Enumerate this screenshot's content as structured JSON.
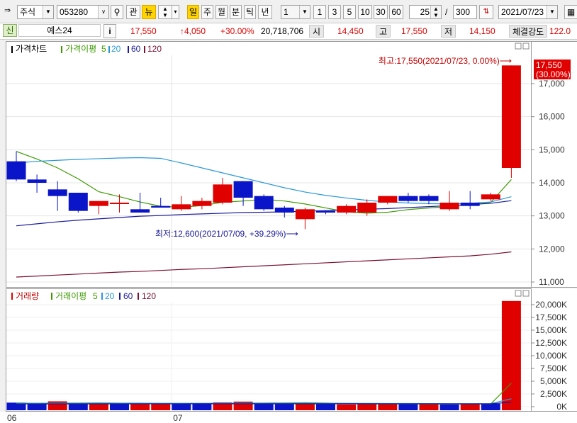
{
  "toolbar": {
    "market_select": "주식",
    "code": "053280",
    "btn_gwan": "관",
    "btn_nyu": "뉴",
    "periods": [
      "일",
      "주",
      "월",
      "분",
      "틱",
      "년"
    ],
    "period_unit": "1",
    "quick_units": [
      "1",
      "3",
      "5",
      "10",
      "30",
      "60"
    ],
    "view_count": "25",
    "slash": "/",
    "total_count": "300",
    "date": "2021/07/23"
  },
  "quote": {
    "badge": "신",
    "name": "예스24",
    "info_btn": "i",
    "price": "17,550",
    "change": "↑4,050",
    "change_pct": "+30.00%",
    "volume": "20,718,706",
    "open_label": "시",
    "open": "14,450",
    "high_label": "고",
    "high": "17,550",
    "low_label": "저",
    "low": "14,150",
    "strength_label": "체결강도",
    "strength": "122.0"
  },
  "price_panel": {
    "legend_title": "가격차트",
    "legend_ma_label": "가격이평",
    "legend_ma_periods": [
      "5",
      "20",
      "60",
      "120"
    ],
    "annotation_high": "최고:17,550(2021/07/23, 0.00%)⟶",
    "annotation_low": "최저:12,600(2021/07/09, +39.29%)⟶",
    "last_price_tag": "17,550",
    "last_pct_tag": "(30.00%)"
  },
  "volume_panel": {
    "legend_title": "거래량",
    "legend_ma_label": "거래이평",
    "legend_ma_periods": [
      "5",
      "20",
      "60",
      "120"
    ]
  },
  "colors": {
    "up": "#e00000",
    "down": "#0a14c8",
    "ma5": "#3c9a00",
    "ma20": "#2a98d8",
    "ma60": "#1a1a9a",
    "ma120": "#7a1030"
  },
  "chart_data": [
    {
      "type": "candlestick",
      "ylim": [
        11000,
        17550
      ],
      "yticks": [
        "11,000",
        "12,000",
        "13,000",
        "14,000",
        "15,000",
        "16,000",
        "17,000"
      ],
      "x_labels": [
        {
          "index": 0,
          "label": "06"
        },
        {
          "index": 8,
          "label": "07"
        }
      ],
      "series": [
        {
          "name": "price",
          "ohlc": [
            [
              14650,
              14950,
              14050,
              14100
            ],
            [
              14100,
              14250,
              13700,
              14000
            ],
            [
              13800,
              14050,
              13150,
              13600
            ],
            [
              13700,
              13700,
              13100,
              13150
            ],
            [
              13300,
              13450,
              13050,
              13450
            ],
            [
              13400,
              13650,
              13100,
              13400
            ],
            [
              13200,
              13700,
              13100,
              13100
            ],
            [
              13300,
              13550,
              13250,
              13250
            ],
            [
              13200,
              13600,
              13150,
              13350
            ],
            [
              13300,
              13550,
              13200,
              13450
            ],
            [
              13400,
              14150,
              13350,
              13950
            ],
            [
              14050,
              14050,
              13300,
              13550
            ],
            [
              13600,
              13650,
              13150,
              13200
            ],
            [
              13250,
              13300,
              12950,
              13100
            ],
            [
              12900,
              13250,
              12600,
              13200
            ],
            [
              13150,
              13150,
              13050,
              13100
            ],
            [
              13100,
              13350,
              13050,
              13300
            ],
            [
              13100,
              13500,
              13000,
              13400
            ],
            [
              13400,
              13600,
              13350,
              13600
            ],
            [
              13600,
              13700,
              13400,
              13450
            ],
            [
              13600,
              13650,
              13350,
              13450
            ],
            [
              13200,
              13750,
              13150,
              13400
            ],
            [
              13400,
              13750,
              13200,
              13300
            ],
            [
              13500,
              13700,
              13450,
              13650
            ],
            [
              14450,
              17550,
              14150,
              17550
            ]
          ]
        },
        {
          "name": "5",
          "values": [
            14950,
            14720,
            14450,
            14120,
            13730,
            13580,
            13420,
            13290,
            13260,
            13310,
            13410,
            13450,
            13500,
            13450,
            13360,
            13240,
            13120,
            13080,
            13110,
            13190,
            13240,
            13280,
            13360,
            13410,
            14100
          ]
        },
        {
          "name": "20",
          "values": [
            14600,
            14650,
            14680,
            14710,
            14730,
            14750,
            14760,
            14740,
            14600,
            14450,
            14300,
            14150,
            14000,
            13850,
            13720,
            13620,
            13540,
            13470,
            13420,
            13390,
            13370,
            13360,
            13380,
            13420,
            13580
          ]
        },
        {
          "name": "60",
          "values": [
            12700,
            12760,
            12820,
            12870,
            12910,
            12950,
            12990,
            13010,
            13040,
            13060,
            13080,
            13100,
            13110,
            13120,
            13140,
            13160,
            13180,
            13200,
            13220,
            13250,
            13280,
            13310,
            13340,
            13380,
            13460
          ]
        },
        {
          "name": "120",
          "values": [
            11150,
            11180,
            11210,
            11240,
            11270,
            11300,
            11320,
            11350,
            11380,
            11400,
            11430,
            11460,
            11490,
            11520,
            11550,
            11580,
            11610,
            11640,
            11670,
            11700,
            11730,
            11760,
            11790,
            11840,
            11910
          ]
        }
      ]
    },
    {
      "type": "bar",
      "ylim": [
        0,
        21000000
      ],
      "yticks": [
        "0K",
        "2,500K",
        "5,000K",
        "7,500K",
        "10,000K",
        "12,500K",
        "15,000K",
        "17,500K",
        "20,000K"
      ],
      "series": [
        {
          "name": "volume",
          "values": [
            800000,
            600000,
            1050000,
            700000,
            600000,
            550000,
            650000,
            600000,
            500000,
            600000,
            850000,
            1000000,
            750000,
            600000,
            700000,
            500000,
            450000,
            500000,
            600000,
            500000,
            650000,
            450000,
            550000,
            600000,
            20718706
          ],
          "up": [
            false,
            false,
            true,
            false,
            true,
            false,
            true,
            true,
            false,
            false,
            true,
            true,
            false,
            false,
            true,
            false,
            true,
            true,
            true,
            false,
            true,
            false,
            true,
            false,
            true
          ]
        },
        {
          "name": "5",
          "values": [
            700000,
            680000,
            700000,
            720000,
            750000,
            700000,
            690000,
            620000,
            580000,
            600000,
            640000,
            700000,
            720000,
            740000,
            780000,
            710000,
            600000,
            550000,
            550000,
            550000,
            540000,
            540000,
            550000,
            550000,
            4600000
          ]
        },
        {
          "name": "20",
          "values": [
            650000,
            650000,
            660000,
            670000,
            680000,
            680000,
            680000,
            670000,
            660000,
            660000,
            660000,
            670000,
            680000,
            680000,
            680000,
            670000,
            660000,
            640000,
            630000,
            620000,
            610000,
            600000,
            600000,
            600000,
            1560000
          ]
        },
        {
          "name": "60",
          "values": [
            550000,
            550000,
            555000,
            560000,
            560000,
            560000,
            565000,
            565000,
            565000,
            570000,
            570000,
            570000,
            575000,
            575000,
            575000,
            575000,
            570000,
            570000,
            565000,
            565000,
            565000,
            560000,
            560000,
            560000,
            900000
          ]
        }
      ]
    }
  ]
}
